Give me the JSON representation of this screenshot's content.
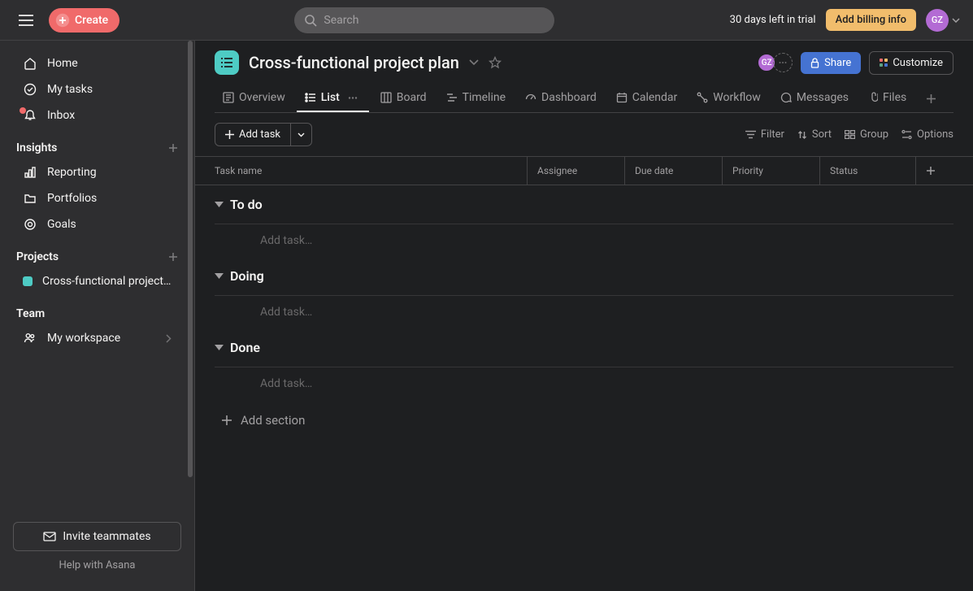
{
  "topbar": {
    "create_label": "Create",
    "search_placeholder": "Search",
    "trial_text": "30 days left in trial",
    "billing_label": "Add billing info",
    "user_initials": "GZ"
  },
  "sidebar": {
    "nav": {
      "home": "Home",
      "my_tasks": "My tasks",
      "inbox": "Inbox"
    },
    "insights": {
      "header": "Insights",
      "reporting": "Reporting",
      "portfolios": "Portfolios",
      "goals": "Goals"
    },
    "projects": {
      "header": "Projects",
      "items": [
        {
          "name": "Cross-functional project …",
          "color": "#4ecbc4"
        }
      ]
    },
    "team": {
      "header": "Team",
      "workspace": "My workspace"
    },
    "invite_label": "Invite teammates",
    "help_label": "Help with Asana"
  },
  "project": {
    "title": "Cross-functional project plan",
    "share_label": "Share",
    "customize_label": "Customize",
    "member_initials": "GZ"
  },
  "tabs": {
    "overview": "Overview",
    "list": "List",
    "board": "Board",
    "timeline": "Timeline",
    "dashboard": "Dashboard",
    "calendar": "Calendar",
    "workflow": "Workflow",
    "messages": "Messages",
    "files": "Files"
  },
  "toolbar": {
    "add_task": "Add task",
    "filter": "Filter",
    "sort": "Sort",
    "group": "Group",
    "options": "Options"
  },
  "columns": {
    "task_name": "Task name",
    "assignee": "Assignee",
    "due_date": "Due date",
    "priority": "Priority",
    "status": "Status"
  },
  "sections": {
    "todo": "To do",
    "doing": "Doing",
    "done": "Done",
    "add_task_placeholder": "Add task…",
    "add_section": "Add section"
  }
}
